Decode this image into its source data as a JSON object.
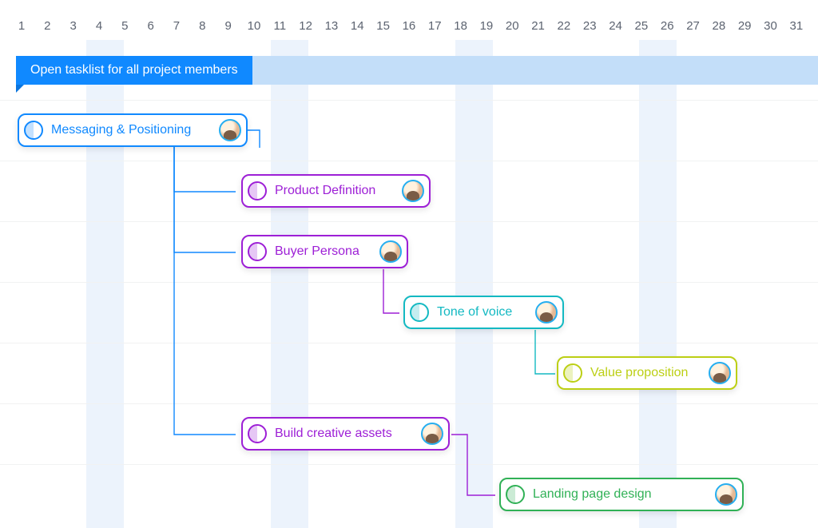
{
  "timeline": {
    "days": [
      "1",
      "2",
      "3",
      "4",
      "5",
      "6",
      "7",
      "8",
      "9",
      "10",
      "11",
      "12",
      "13",
      "14",
      "15",
      "16",
      "17",
      "18",
      "19",
      "20",
      "21",
      "22",
      "23",
      "24",
      "25",
      "26",
      "27",
      "28",
      "29",
      "30",
      "31"
    ]
  },
  "banner": {
    "title": "Open tasklist for all project members"
  },
  "tasks": {
    "messaging": {
      "label": "Messaging & Positioning",
      "color": "blue",
      "avatar": "avatar-a"
    },
    "product_def": {
      "label": "Product Definition",
      "color": "purple",
      "avatar": "avatar-b"
    },
    "buyer_persona": {
      "label": "Buyer Persona",
      "color": "purple",
      "avatar": "avatar-a"
    },
    "tone_of_voice": {
      "label": "Tone of voice",
      "color": "cyan",
      "avatar": "avatar-b"
    },
    "value_prop": {
      "label": "Value proposition",
      "color": "olive",
      "avatar": "avatar-c"
    },
    "creative_assets": {
      "label": "Build creative assets",
      "color": "purple",
      "avatar": "avatar-c"
    },
    "landing_page": {
      "label": "Landing  page design",
      "color": "green",
      "avatar": "avatar-c"
    }
  },
  "colors": {
    "blue": "#1089ff",
    "purple": "#9d1fd6",
    "cyan": "#13b9c2",
    "olive": "#bccf14",
    "green": "#30b156"
  }
}
